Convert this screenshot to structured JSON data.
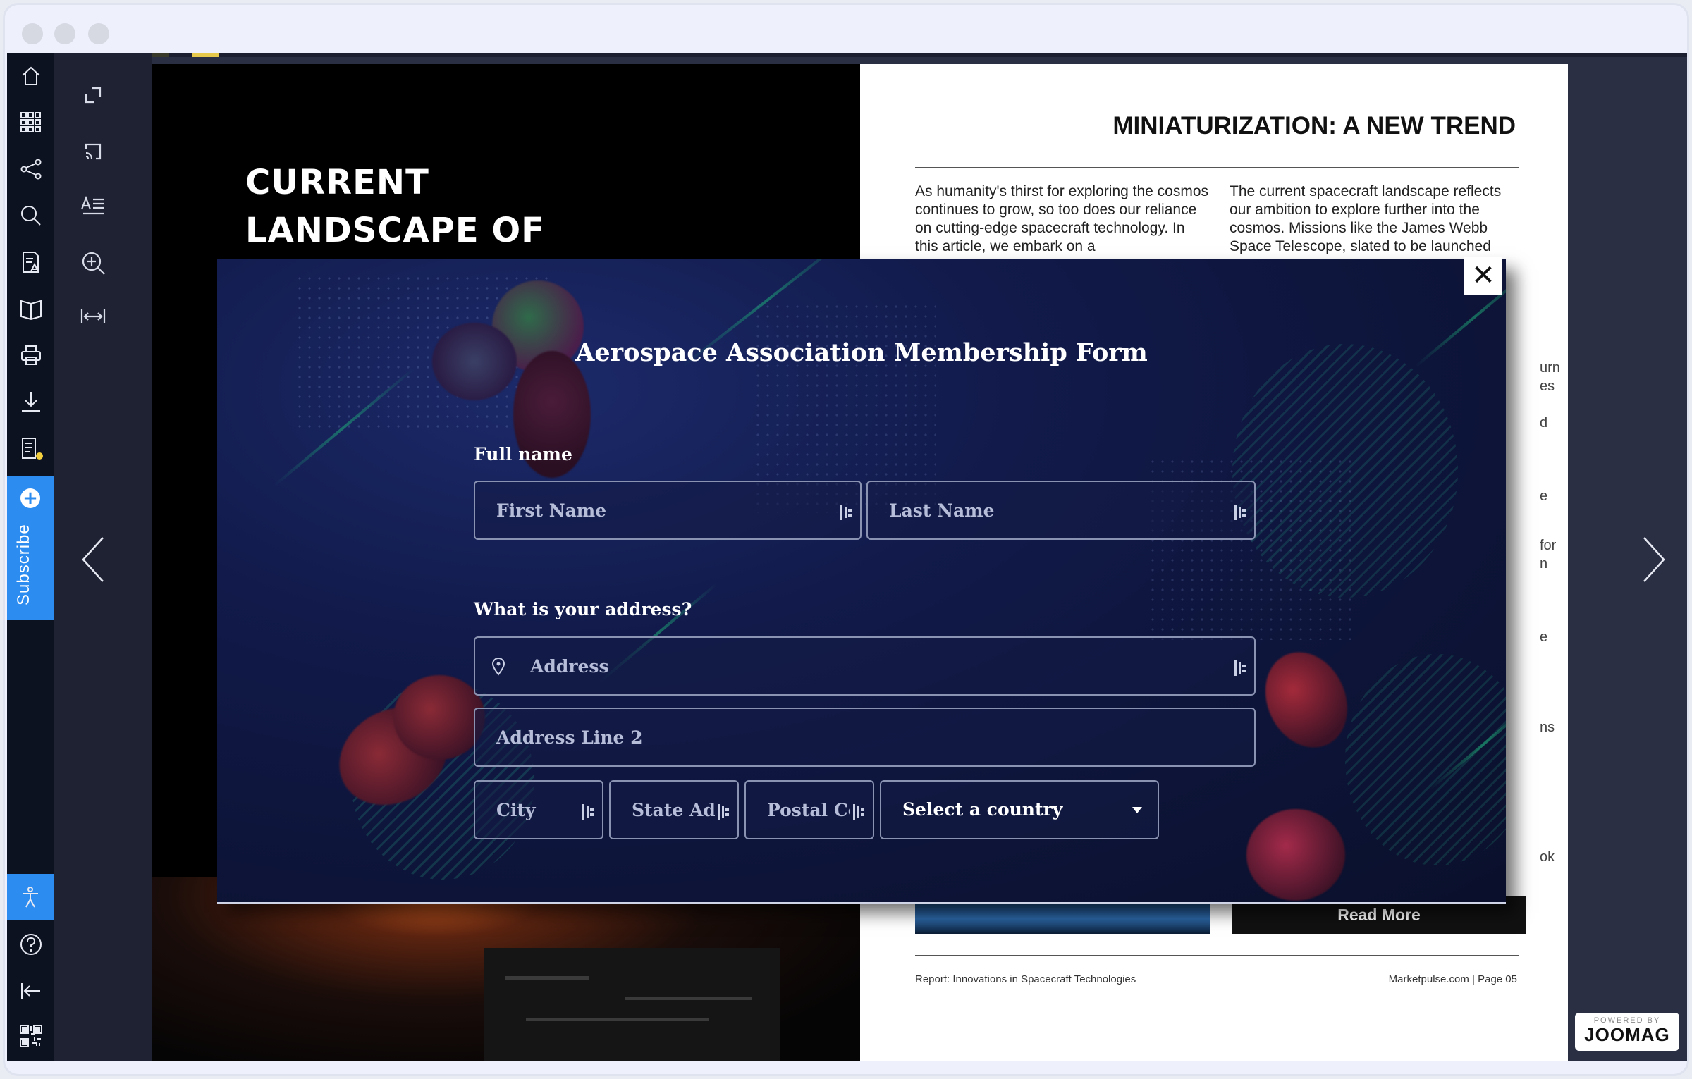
{
  "sidebar": {
    "subscribe_label": "Subscribe",
    "icons": [
      "home-icon",
      "grid-icon",
      "share-icon",
      "search-icon",
      "text-view-icon",
      "book-icon",
      "print-icon",
      "download-icon",
      "notes-icon"
    ],
    "bottom_icons": [
      "accessibility-icon",
      "help-icon",
      "collapse-icon",
      "qr-code-icon"
    ]
  },
  "toolbar": {
    "icons": [
      "fullscreen-icon",
      "cast-icon",
      "text-mode-icon",
      "zoom-in-icon",
      "fit-width-icon"
    ]
  },
  "left_page": {
    "heading_line1": "CURRENT",
    "heading_line2": "LANDSCAPE OF"
  },
  "right_page": {
    "title": "MINIATURIZATION: A NEW TREND",
    "col1": "As humanity's thirst for exploring the cosmos continues to grow, so too does our reliance on cutting-edge spacecraft technology. In this article, we embark on a",
    "col2": "The current spacecraft landscape reflects our ambition to explore further into the cosmos. Missions like the James Webb Space Telescope, slated to be launched",
    "side_fragments": [
      "urn",
      "es",
      "d",
      "e",
      "for",
      "n",
      "e",
      "ns",
      "ok"
    ],
    "read_more": "Read More",
    "footer_left": "Report: Innovations in Spacecraft Technologies",
    "footer_right": "Marketpulse.com  |  Page 05"
  },
  "modal": {
    "title": "Aerospace Association Membership Form",
    "close_label": "✕",
    "full_name_label": "Full name",
    "first_name_placeholder": "First Name",
    "last_name_placeholder": "Last Name",
    "address_label": "What is your address?",
    "address_placeholder": "Address",
    "address2_placeholder": "Address Line 2",
    "city_placeholder": "City",
    "state_placeholder": "State Add",
    "postal_placeholder": "Postal Coc",
    "country_select": "Select a country"
  },
  "branding": {
    "powered_by": "POWERED BY",
    "name": "JOOMAG"
  },
  "colors": {
    "accent": "#2d8cf0",
    "sidebar_bg": "#0d1220",
    "modal_bg": "#111a4a"
  }
}
